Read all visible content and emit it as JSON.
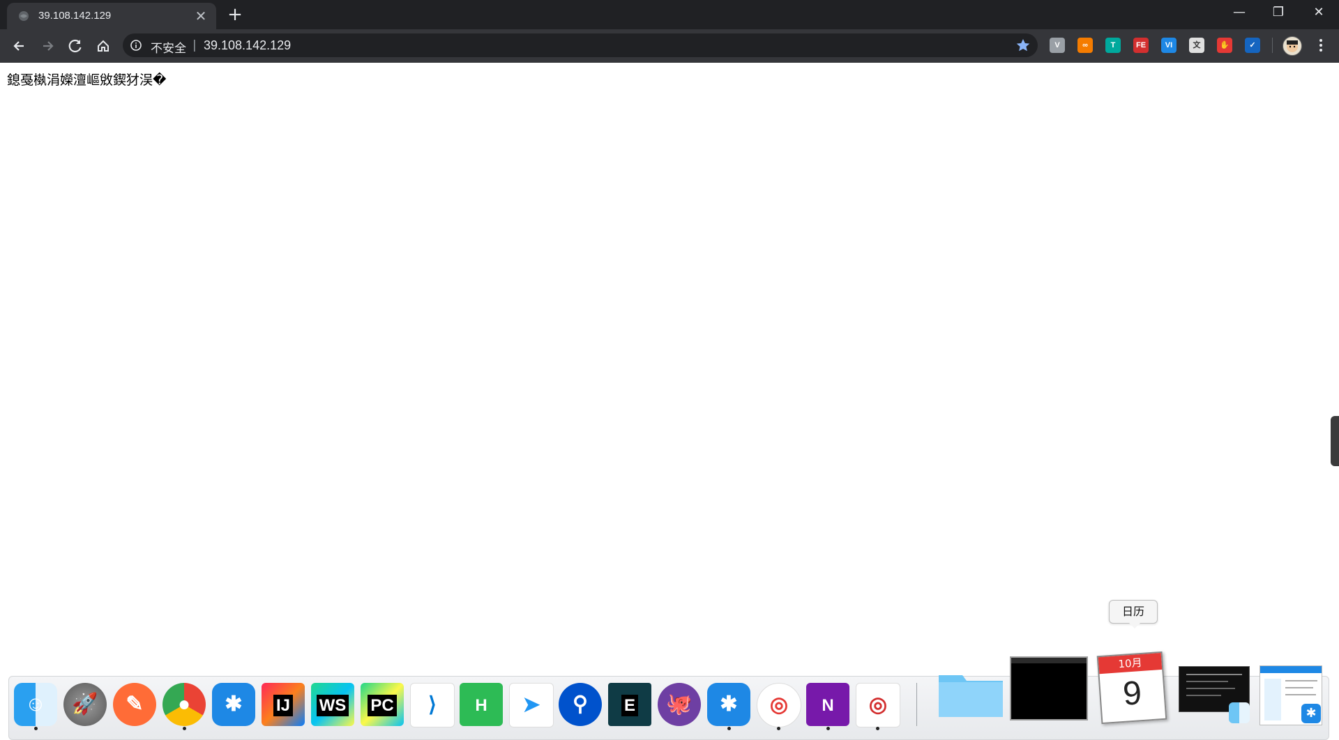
{
  "browser": {
    "tab_title": "39.108.142.129",
    "tab_close": "✕",
    "new_tab": "+",
    "window_controls": {
      "minimize": "—",
      "restore": "❐",
      "close": "✕"
    },
    "omnibox": {
      "insecure_label": "不安全",
      "separator": "|",
      "url": "39.108.142.129"
    },
    "extensions": [
      {
        "name": "vimium-icon",
        "text": "V",
        "color": "#9aa0a6"
      },
      {
        "name": "infinity-icon",
        "text": "∞",
        "color": "#f57c00"
      },
      {
        "name": "t-extension-icon",
        "text": "T",
        "color": "#00a99d"
      },
      {
        "name": "fe-helper-icon",
        "text": "FE",
        "color": "#d32f2f"
      },
      {
        "name": "vi-extension-icon",
        "text": "VI",
        "color": "#1e88e5"
      },
      {
        "name": "translate-extension-icon",
        "text": "文",
        "color": "#e0e0e0"
      },
      {
        "name": "adblock-icon",
        "text": "✋",
        "color": "#e53935"
      },
      {
        "name": "checkmark-extension-icon",
        "text": "✓",
        "color": "#1565c0"
      }
    ]
  },
  "page": {
    "garbled_text": "鎴戞槸涓嬫澶嶇敓鍥犲洖�"
  },
  "dock": {
    "tooltip": "日历",
    "calendar": {
      "month": "10月",
      "day": "9"
    },
    "apps": [
      {
        "name": "finder-icon",
        "label": ""
      },
      {
        "name": "launchpad-icon",
        "label": ""
      },
      {
        "name": "postman-icon",
        "label": ""
      },
      {
        "name": "chrome-icon",
        "label": ""
      },
      {
        "name": "dingtalk-icon",
        "label": ""
      },
      {
        "name": "intellij-icon",
        "label": "IJ"
      },
      {
        "name": "webstorm-icon",
        "label": "WS"
      },
      {
        "name": "pycharm-icon",
        "label": "PC"
      },
      {
        "name": "vscode-icon",
        "label": ""
      },
      {
        "name": "hbuilder-icon",
        "label": "H"
      },
      {
        "name": "send-icon",
        "label": ""
      },
      {
        "name": "sourcetree-icon",
        "label": ""
      },
      {
        "name": "e-terminal-icon",
        "label": "E"
      },
      {
        "name": "github-icon",
        "label": ""
      },
      {
        "name": "dingtalk2-icon",
        "label": ""
      },
      {
        "name": "swift-swirl-icon",
        "label": ""
      },
      {
        "name": "onenote-icon",
        "label": "N"
      },
      {
        "name": "swirl-red-icon",
        "label": ""
      }
    ]
  }
}
